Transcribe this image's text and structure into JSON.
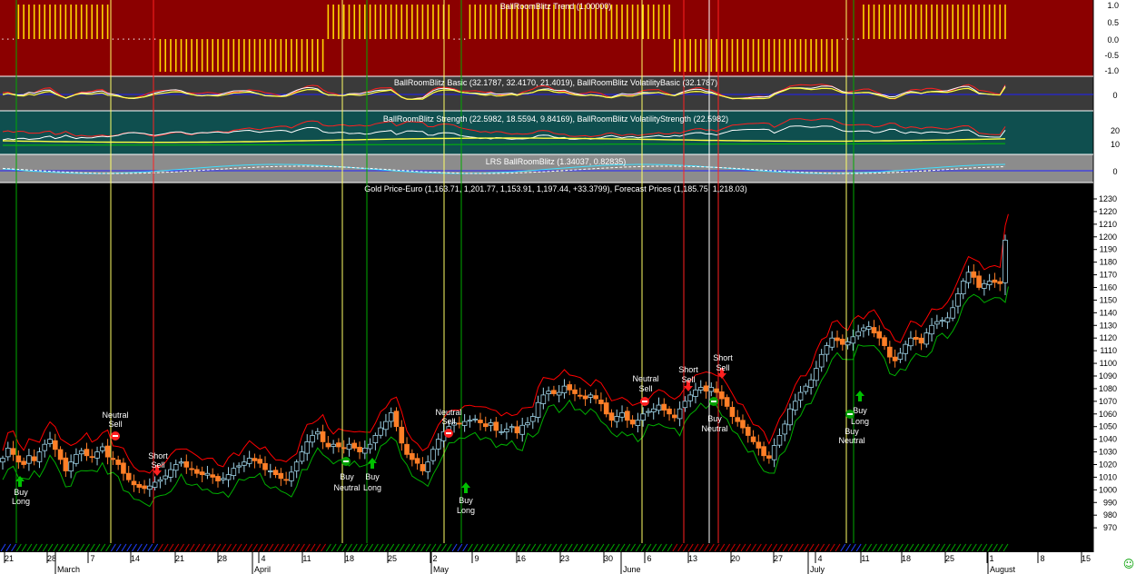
{
  "panels": {
    "trend": {
      "title": "BallRoomBlitz Trend (1.00000)",
      "ticks": [
        "1.0",
        "0.5",
        "0.0",
        "-0.5",
        "-1.0"
      ],
      "colors": {
        "bg": "#8b0000",
        "bar": "#ffd700"
      }
    },
    "basic": {
      "title": "BallRoomBlitz Basic (32.1787, 32.4170, 21.4019), BallRoomBlitz VolatilityBasic (32.1787)",
      "ticks": [
        "0"
      ]
    },
    "strength": {
      "title": "BallRoomBlitz Strength (22.5982, 18.5594, 9.84169), BallRoomBlitz VolatilityStrength (22.5982)",
      "ticks": [
        "20",
        "10"
      ]
    },
    "lrs": {
      "title": "LRS BallRoomBlitz (1.34037, 0.82835)",
      "ticks": [
        "0"
      ]
    },
    "price": {
      "title": "Gold Price-Euro (1,163.71, 1,201.77, 1,153.91, 1,197.44, +33.3799), Forecast Prices (1,185.75, 1,218.03)",
      "ticks": [
        "1230",
        "1220",
        "1210",
        "1200",
        "1190",
        "1180",
        "1170",
        "1160",
        "1150",
        "1140",
        "1130",
        "1120",
        "1110",
        "1100",
        "1090",
        "1080",
        "1070",
        "1060",
        "1050",
        "1040",
        "1030",
        "1020",
        "1010",
        "1000",
        "990",
        "980",
        "970"
      ]
    }
  },
  "x_axis": {
    "dates": [
      "21",
      "28",
      "7",
      "14",
      "21",
      "28",
      "4",
      "11",
      "18",
      "25",
      "2",
      "9",
      "16",
      "23",
      "30",
      "6",
      "13",
      "20",
      "27",
      "4",
      "11",
      "18",
      "25",
      "1",
      "8",
      "15"
    ],
    "months": [
      "March",
      "April",
      "May",
      "June",
      "July",
      "August"
    ]
  },
  "signals": [
    {
      "label1": "Buy",
      "label2": "Long",
      "type": "buy"
    },
    {
      "label1": "Neutral",
      "label2": "Sell",
      "type": "neutral-sell"
    },
    {
      "label1": "Short",
      "label2": "Sell",
      "type": "short"
    },
    {
      "label1": "Buy",
      "label2": "Neutral",
      "type": "buy-neutral"
    },
    {
      "label1": "Buy",
      "label2": "Long",
      "type": "buy"
    },
    {
      "label1": "Neutral",
      "label2": "Sell",
      "type": "neutral-sell"
    },
    {
      "label1": "Buy",
      "label2": "Long",
      "type": "buy"
    },
    {
      "label1": "Neutral",
      "label2": "Sell",
      "type": "neutral-sell"
    },
    {
      "label1": "Short",
      "label2": "Sell",
      "type": "short"
    },
    {
      "label1": "Buy",
      "label2": "Neutral",
      "type": "buy-neutral"
    },
    {
      "label1": "Short",
      "label2": "Sell",
      "type": "short"
    },
    {
      "label1": "Buy",
      "label2": "Long",
      "type": "buy"
    },
    {
      "label1": "Buy",
      "label2": "Neutral",
      "type": "buy-neutral"
    }
  ],
  "colors": {
    "up": "#9ed2e6",
    "down": "#ff7f27",
    "upper_band": "#ff0000",
    "lower_band": "#00b000",
    "vline_yellow": "#ffff66",
    "vline_green": "#00aa00",
    "vline_red": "#ff2020",
    "vline_white": "#ffffff",
    "basic_bg": "#3a3a3a",
    "strength_bg": "#0f4f4f",
    "lrs_bg": "#8c8c8c",
    "price_bg": "#000000"
  },
  "chart_data": {
    "type": "candlestick",
    "title": "Gold Price-Euro (1,163.71, 1,201.77, 1,153.91, 1,197.44, +33.3799), Forecast Prices (1,185.75, 1,218.03)",
    "ylim": [
      962,
      1236
    ],
    "close": [
      1025,
      1033,
      1028,
      1022,
      1020,
      1027,
      1023,
      1030,
      1036,
      1040,
      1032,
      1024,
      1015,
      1022,
      1028,
      1031,
      1027,
      1026,
      1030,
      1034,
      1026,
      1024,
      1020,
      1013,
      1008,
      1004,
      1002,
      1001,
      1003,
      1006,
      1008,
      1011,
      1016,
      1020,
      1022,
      1018,
      1016,
      1013,
      1012,
      1013,
      1010,
      1007,
      1009,
      1012,
      1017,
      1019,
      1022,
      1025,
      1023,
      1021,
      1016,
      1015,
      1012,
      1009,
      1008,
      1014,
      1022,
      1030,
      1038,
      1043,
      1046,
      1038,
      1034,
      1036,
      1034,
      1033,
      1036,
      1033,
      1030,
      1033,
      1036,
      1043,
      1049,
      1054,
      1061,
      1050,
      1037,
      1028,
      1024,
      1021,
      1015,
      1022,
      1032,
      1040,
      1046,
      1050,
      1053,
      1052,
      1054,
      1055,
      1056,
      1053,
      1050,
      1053,
      1047,
      1046,
      1048,
      1050,
      1045,
      1051,
      1053,
      1058,
      1069,
      1075,
      1078,
      1076,
      1077,
      1082,
      1079,
      1076,
      1074,
      1072,
      1075,
      1072,
      1068,
      1060,
      1055,
      1058,
      1061,
      1055,
      1052,
      1055,
      1060,
      1062,
      1064,
      1067,
      1063,
      1060,
      1057,
      1064,
      1070,
      1075,
      1079,
      1081,
      1078,
      1081,
      1077,
      1072,
      1066,
      1058,
      1054,
      1049,
      1043,
      1038,
      1033,
      1027,
      1025,
      1035,
      1043,
      1052,
      1064,
      1070,
      1077,
      1082,
      1087,
      1096,
      1107,
      1114,
      1120,
      1118,
      1115,
      1117,
      1121,
      1125,
      1128,
      1129,
      1124,
      1120,
      1114,
      1105,
      1102,
      1108,
      1115,
      1120,
      1119,
      1116,
      1124,
      1130,
      1133,
      1134,
      1136,
      1144,
      1155,
      1165,
      1172,
      1168,
      1160,
      1163,
      1165,
      1164,
      1163,
      1197
    ],
    "forecast_upper": [
      1218.03
    ],
    "forecast_lower": [
      1185.75
    ],
    "last_bar": {
      "open": 1163.71,
      "high": 1201.77,
      "low": 1153.91,
      "close": 1197.44,
      "change": 33.3799
    }
  }
}
